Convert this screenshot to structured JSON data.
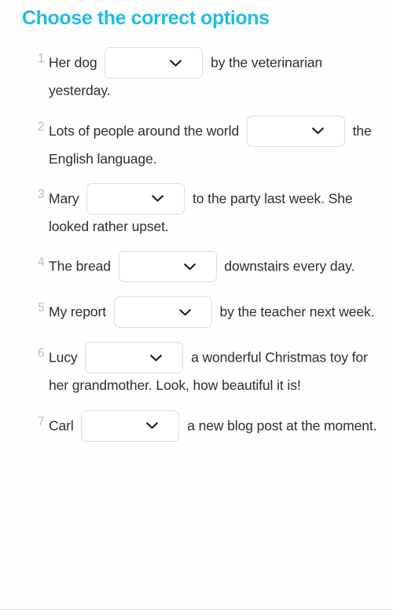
{
  "header": {
    "title": "Choose the correct options",
    "title_color": "#21bce4"
  },
  "icons": {
    "chevron_down": "chevron-down-icon"
  },
  "dropdown": {
    "value": "",
    "placeholder": ""
  },
  "questions": [
    {
      "number": "1",
      "before": "Her dog ",
      "after": " by the veterinarian yesterday."
    },
    {
      "number": "2",
      "before": "Lots of people around the world ",
      "after": " the English language."
    },
    {
      "number": "3",
      "before": "Mary ",
      "after": " to the party last week. She looked rather upset."
    },
    {
      "number": "4",
      "before": "The bread ",
      "after": " downstairs every day."
    },
    {
      "number": "5",
      "before": "My report ",
      "after": " by the teacher next week."
    },
    {
      "number": "6",
      "before": "Lucy ",
      "after": " a wonderful Christmas toy for her grandmother. Look, how beautiful it is!"
    },
    {
      "number": "7",
      "before": "Carl ",
      "after": " a new blog post at the moment."
    }
  ]
}
